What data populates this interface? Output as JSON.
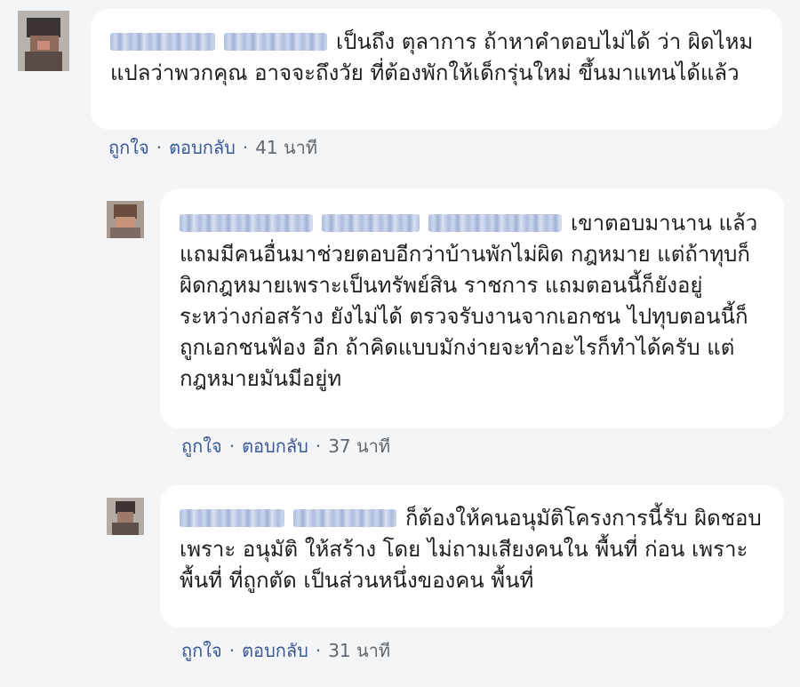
{
  "comments": [
    {
      "text_before": "",
      "text": "เป็นถึง ตุลาการ ถ้าหาคำตอบไม่ได้ ว่า ผิดไหม แปลว่าพวกคุณ อาจจะถึงวัย ที่ต้องพักให้เด็กรุ่นใหม่ ขึ้นมาแทนได้แล้ว",
      "like": "ถูกใจ",
      "reply": "ตอบกลับ",
      "time": "41 นาที"
    },
    {
      "text": "เขาตอบมานาน แล้วแถมมีคนอื่นมาช่วยตอบอีกว่าบ้านพักไม่ผิด กฎหมาย แต่ถ้าทุบก็ผิดกฎหมายเพราะเป็นทรัพย์สิน ราชการ แถมตอนนี้ก็ยังอยู่ระหว่างก่อสร้าง ยังไม่ได้ ตรวจรับงานจากเอกชน ไปทุบตอนนี้ก็ถูกเอกชนฟ้อง อีก ถ้าคิดแบบมักง่ายจะทำอะไรก็ทำได้ครับ แต่ กฎหมายมันมีอยู่ท",
      "like": "ถูกใจ",
      "reply": "ตอบกลับ",
      "time": "37 นาที"
    },
    {
      "text": "ก็ต้องให้คนอนุมัติโครงการนี้รับ ผิดชอบ เพราะ อนุมัติ ให้สร้าง โดย ไม่ถามเสียงคนใน พื้นที่ ก่อน เพราะ พื้นที่ ที่ถูกตัด เป็นส่วนหนึ่งของคน พื้นที่",
      "like": "ถูกใจ",
      "reply": "ตอบกลับ",
      "time": "31 นาที"
    }
  ],
  "colors": {
    "background": "#f4f5f7",
    "bubble": "#ffffff",
    "link": "#385898",
    "meta": "#606770"
  }
}
